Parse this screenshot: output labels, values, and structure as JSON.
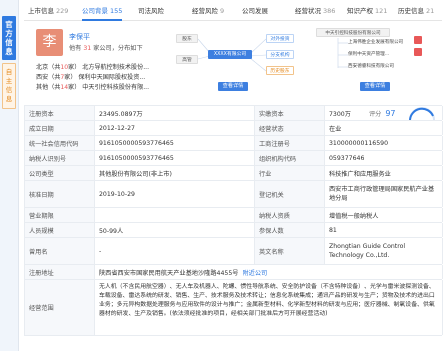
{
  "side": {
    "official": "官方信息",
    "self": "自主信息"
  },
  "tabs": [
    {
      "label": "上市信息",
      "count": "229"
    },
    {
      "label": "公司背景",
      "count": "155"
    },
    {
      "label": "司法风险",
      "count": ""
    },
    {
      "label": "经营风险",
      "count": "9"
    },
    {
      "label": "公司发展",
      "count": ""
    },
    {
      "label": "经营状况",
      "count": "386"
    },
    {
      "label": "知识产权",
      "count": "121"
    },
    {
      "label": "历史信息",
      "count": "21"
    }
  ],
  "person": {
    "avatar": "李",
    "name": "李保平",
    "sub_prefix": "他有",
    "sub_count": "31",
    "sub_suffix": "家公司，分布如下",
    "companies": [
      {
        "city": "北京",
        "count": "10",
        "unit": "家",
        "name": "北方导航控制技术股份..."
      },
      {
        "city": "西安",
        "count": "7",
        "unit": "家",
        "name": "保利中天国际股权投资..."
      },
      {
        "city": "其他",
        "count": "14",
        "unit": "家",
        "name": "中天引控科技股份有限..."
      }
    ]
  },
  "graph1": {
    "nodes": [
      "股东",
      "高管",
      "XXXX有限公司",
      "对外投资",
      "分支机构",
      "历史股东"
    ],
    "button": "查看详情"
  },
  "graph2": {
    "top": "中天引控科技股份有限公司",
    "rows": [
      "上海伟胜企业发展有限公司",
      "保利中天资产管理...",
      "西安德睿科技有限公司"
    ],
    "button": "查看详情"
  },
  "info": {
    "rows": [
      {
        "l1": "注册资本",
        "v1": "23495.0897万",
        "l2": "实缴资本",
        "v2": "7300万"
      },
      {
        "l1": "成立日期",
        "v1": "2012-12-27",
        "l2": "经营状态",
        "v2": "在业"
      },
      {
        "l1": "统一社会信用代码",
        "v1": "9161050000593776465",
        "l2": "工商注册号",
        "v2": "310000000116590"
      },
      {
        "l1": "纳税人识别号",
        "v1": "9161050000593776465",
        "l2": "组织机构代码",
        "v2": "059377646"
      },
      {
        "l1": "公司类型",
        "v1": "其他股份有限公司(非上市)",
        "l2": "行业",
        "v2": "科技推广和应用服务业"
      },
      {
        "l1": "核准日期",
        "v1": "2019-10-29",
        "l2": "登记机关",
        "v2": "西安市工商行政管理局国家民航产业基地分局"
      },
      {
        "l1": "营业期限",
        "v1": "",
        "l2": "纳税人资质",
        "v2": "增值税一般纳税人"
      },
      {
        "l1": "人员规模",
        "v1": "50-99人",
        "l2": "参保人数",
        "v2": "81"
      },
      {
        "l1": "曾用名",
        "v1": "-",
        "l2": "英文名称",
        "v2": "Zhongtian Guide Control Technology Co.,Ltd."
      }
    ],
    "score_label": "评分",
    "score": "97",
    "address_label": "注册地址",
    "address": "陕西省西安市国家民用航天产业基地沙隆路4455号",
    "address_link": "附近公司",
    "scope_label": "经营范围",
    "scope": "无人机（不含民用航空器）、无人车及机器人、陀螺、惯性导航系统、安全防护设备（不含特种设备）、光学与雷米波探测设备、车载设备、雷达系统的研发、销售、生产、技术服务及技术转让；信息化系统集成；通讯产品的研发与生产；货物及技术的进出口业务；多元异构数据处理服务与应用软件的设计与推广；金属新型材料、化学新型材料的研发与应用；医疗器械、制氧设备、供氧器材的研发、生产及销售。(依法须经批准的项目，经相关部门批准后方可开展经营活动)"
  }
}
